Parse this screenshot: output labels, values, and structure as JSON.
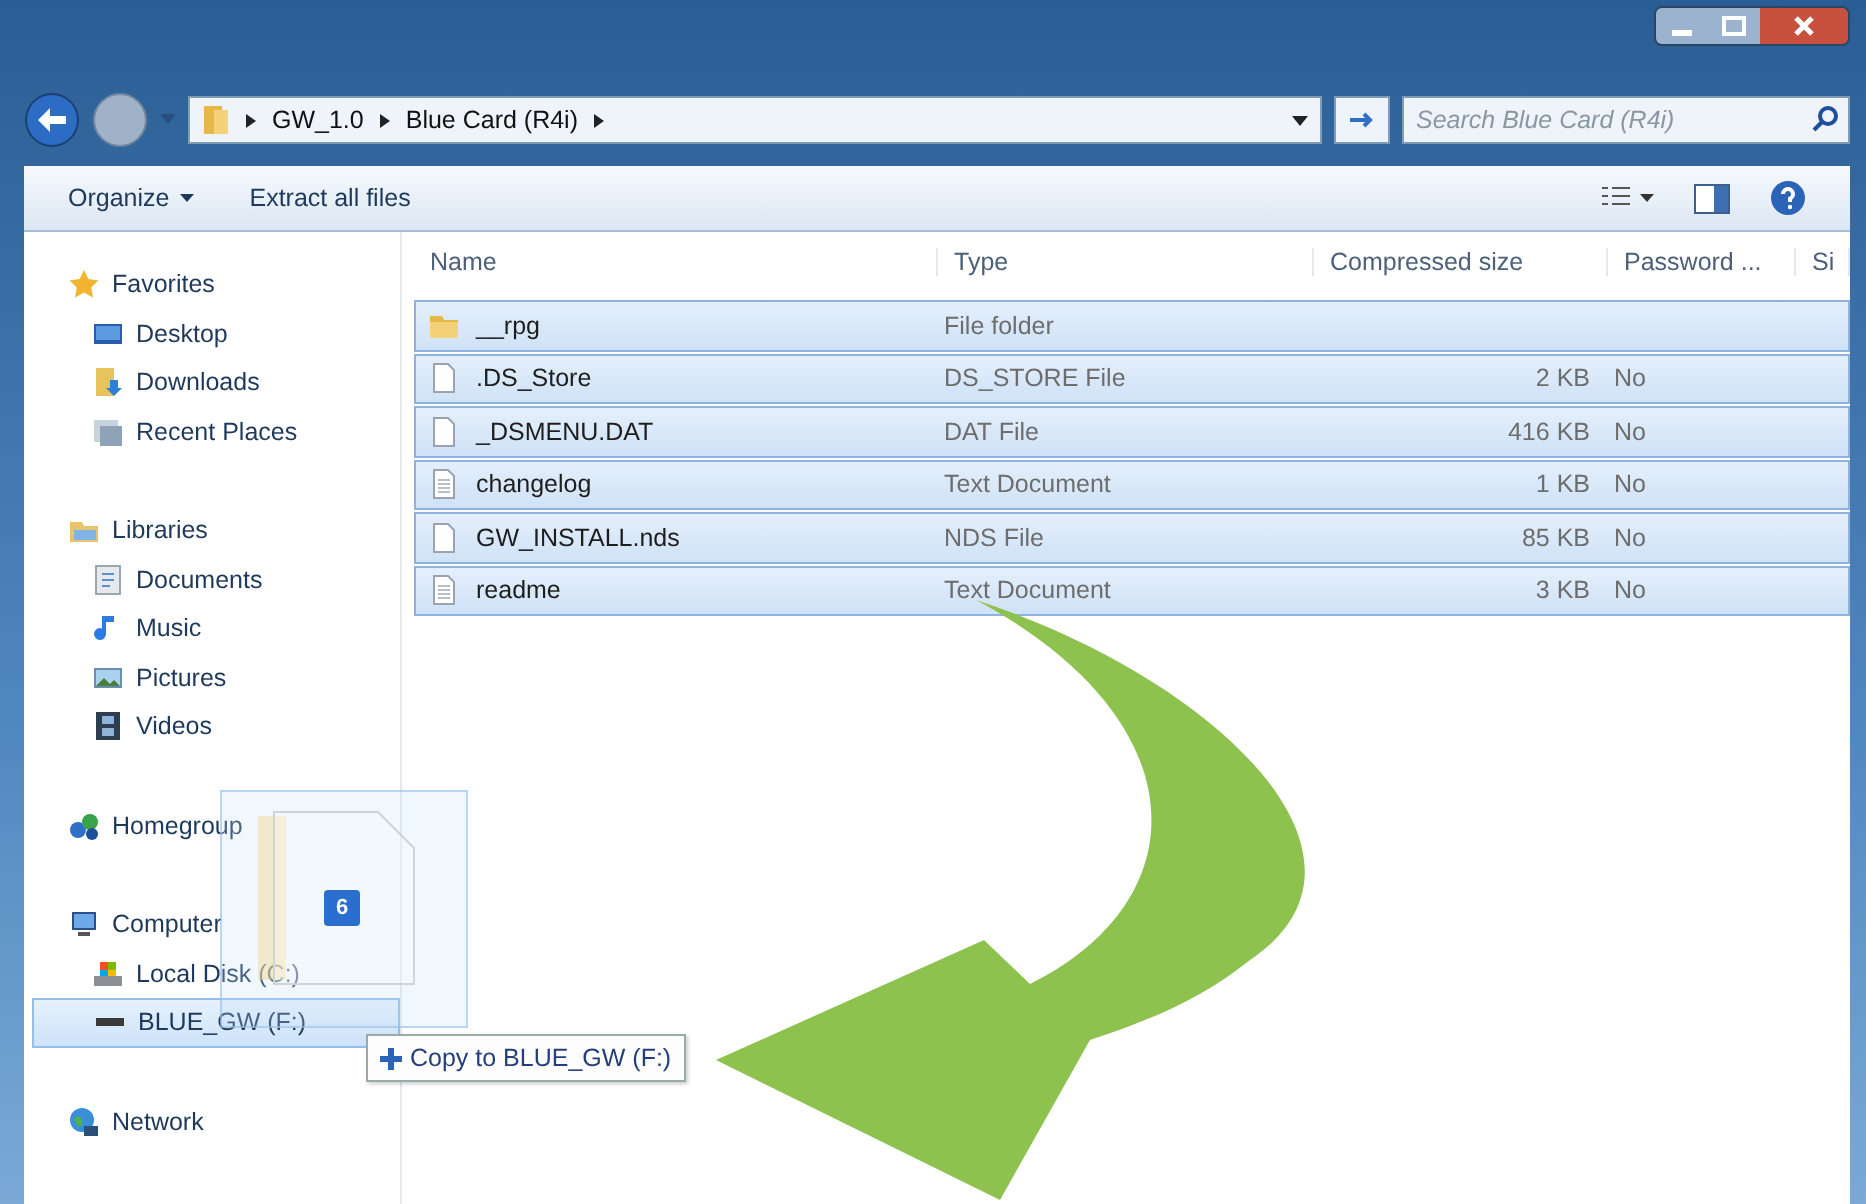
{
  "address": {
    "breadcrumbs": [
      "GW_1.0",
      "Blue Card (R4i)"
    ]
  },
  "search": {
    "placeholder": "Search Blue Card (R4i)"
  },
  "toolbar": [
    {
      "label": "Organize",
      "kind": "menu"
    },
    {
      "label": "Extract all files",
      "kind": "plain"
    }
  ],
  "sidebar": {
    "groups": [
      {
        "label": "Favorites",
        "kind": "star",
        "selected": false,
        "children": [
          {
            "label": "Desktop",
            "kind": "desktop",
            "selected": false
          },
          {
            "label": "Downloads",
            "kind": "downloads",
            "selected": false
          },
          {
            "label": "Recent Places",
            "kind": "recent",
            "selected": false
          }
        ]
      },
      {
        "label": "Libraries",
        "kind": "libraries",
        "selected": false,
        "children": [
          {
            "label": "Documents",
            "kind": "documents",
            "selected": false
          },
          {
            "label": "Music",
            "kind": "music",
            "selected": false
          },
          {
            "label": "Pictures",
            "kind": "pictures",
            "selected": false
          },
          {
            "label": "Videos",
            "kind": "videos",
            "selected": false
          }
        ]
      },
      {
        "label": "Homegroup",
        "kind": "homegroup",
        "selected": false
      },
      {
        "label": "Computer",
        "kind": "computer",
        "selected": false,
        "children": [
          {
            "label": "Local Disk (C:)",
            "kind": "disk",
            "selected": false
          },
          {
            "label": "BLUE_GW (F:)",
            "kind": "drive",
            "selected": true
          }
        ]
      },
      {
        "label": "Network",
        "kind": "network",
        "selected": false
      }
    ]
  },
  "table": {
    "columns": [
      "Name",
      "Type",
      "Compressed size",
      "Password ...",
      "Si"
    ],
    "rows": [
      {
        "name": "__rpg",
        "type": "File folder",
        "kind": "folder",
        "selected": true
      },
      {
        "name": ".DS_Store",
        "type": "DS_STORE File",
        "size": "2 KB",
        "password": "No",
        "kind": "file",
        "selected": true
      },
      {
        "name": "_DSMENU.DAT",
        "type": "DAT File",
        "size": "416 KB",
        "password": "No",
        "kind": "file",
        "selected": true
      },
      {
        "name": "changelog",
        "type": "Text Document",
        "size": "1 KB",
        "password": "No",
        "kind": "text",
        "selected": true
      },
      {
        "name": "GW_INSTALL.nds",
        "type": "NDS File",
        "size": "85 KB",
        "password": "No",
        "kind": "file",
        "selected": true
      },
      {
        "name": "readme",
        "type": "Text Document",
        "size": "3 KB",
        "password": "No",
        "kind": "text",
        "selected": true
      }
    ]
  },
  "drag": {
    "count": "6",
    "tooltip": "Copy to BLUE_GW (F:)"
  }
}
